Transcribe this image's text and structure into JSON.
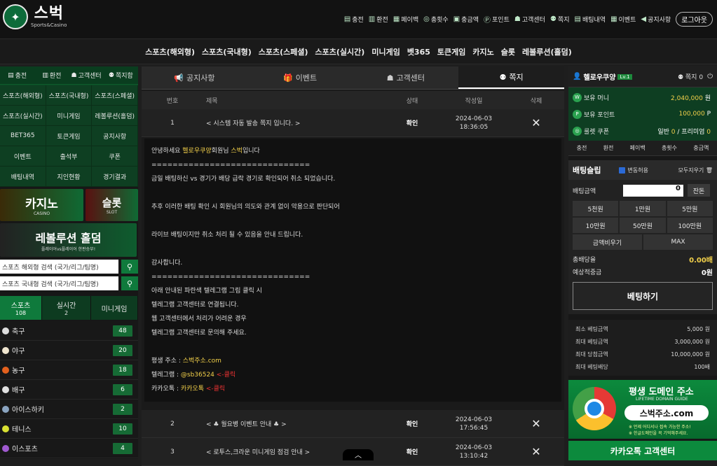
{
  "logo": {
    "title": "스벅",
    "subtitle": "Sports&Casino"
  },
  "topmenu": [
    {
      "icon": "charge-icon",
      "glyph": "▤",
      "label": "충전"
    },
    {
      "icon": "exchange-icon",
      "glyph": "▥",
      "label": "환전"
    },
    {
      "icon": "payback-icon",
      "glyph": "▦",
      "label": "페이백"
    },
    {
      "icon": "total-charge-icon",
      "glyph": "◎",
      "label": "총횟수"
    },
    {
      "icon": "total-amount-icon",
      "glyph": "▣",
      "label": "충금액"
    },
    {
      "icon": "point-icon",
      "glyph": "Ⓟ",
      "label": "포인트"
    },
    {
      "icon": "support-icon",
      "glyph": "☗",
      "label": "고객센터"
    },
    {
      "icon": "message-icon",
      "glyph": "⚉",
      "label": "쪽지"
    },
    {
      "icon": "bet-history-icon",
      "glyph": "▤",
      "label": "배팅내역"
    },
    {
      "icon": "event-icon",
      "glyph": "▦",
      "label": "이벤트"
    },
    {
      "icon": "notice-icon",
      "glyph": "◀",
      "label": "공지사항"
    }
  ],
  "logout": "로그아웃",
  "mainnav": [
    "스포츠(해외형)",
    "스포츠(국내형)",
    "스포츠(스페셜)",
    "스포츠(실시간)",
    "미니게임",
    "벳365",
    "토큰게임",
    "카지노",
    "슬롯",
    "레볼루션(홀덤)"
  ],
  "left": {
    "quick": [
      {
        "glyph": "▤",
        "label": "충전"
      },
      {
        "glyph": "▥",
        "label": "환전"
      },
      {
        "glyph": "☗",
        "label": "고객센터"
      },
      {
        "glyph": "⚉",
        "label": "쪽지함"
      }
    ],
    "grid": [
      "스포츠(해외형)",
      "스포츠(국내형)",
      "스포츠(스페셜)",
      "스포츠(실시간)",
      "미니게임",
      "레볼루션(홀덤)",
      "BET365",
      "토큰게임",
      "공지사항",
      "이벤트",
      "출석부",
      "쿠폰",
      "배팅내역",
      "지인현황",
      "경기결과"
    ],
    "banner_casino": "카지노",
    "banner_casino_sub": "CASINO",
    "banner_slot": "슬롯",
    "banner_slot_sub": "SLOT",
    "banner_holdem": "레볼루션 홀덤",
    "banner_holdem_sub": "플레이어vs플레이어 한판승부!",
    "search1": "스포츠 해외형 검색 (국가/리그/팀명)",
    "search2": "스포츠 국내형 검색 (국가/리그/팀명)",
    "tabs": [
      {
        "label": "스포츠",
        "count": "108"
      },
      {
        "label": "실시간",
        "count": "2"
      },
      {
        "label": "미니게임",
        "count": ""
      }
    ],
    "sports": [
      {
        "name": "축구",
        "count": "48",
        "color": "#dddddd"
      },
      {
        "name": "야구",
        "count": "20",
        "color": "#f0e6d0"
      },
      {
        "name": "농구",
        "count": "18",
        "color": "#e3611e"
      },
      {
        "name": "배구",
        "count": "6",
        "color": "#e0e0e0"
      },
      {
        "name": "아이스하키",
        "count": "2",
        "color": "#8aa4c0"
      },
      {
        "name": "테니스",
        "count": "10",
        "color": "#d8e032"
      },
      {
        "name": "이스포츠",
        "count": "4",
        "color": "#a05ad0"
      }
    ]
  },
  "center": {
    "tabs": [
      {
        "glyph": "📢",
        "label": "공지사항"
      },
      {
        "glyph": "🎁",
        "label": "이벤트"
      },
      {
        "glyph": "☗",
        "label": "고객센터"
      },
      {
        "glyph": "⚉",
        "label": "쪽지"
      }
    ],
    "headers": {
      "no": "번호",
      "title": "제목",
      "status": "상태",
      "date": "작성일",
      "del": "삭제"
    },
    "row1": {
      "no": "1",
      "title": "< 시스템 자동 발송 쪽지 입니다. >",
      "status": "확인",
      "date": "2024-06-03",
      "time": "18:36:05"
    },
    "message": {
      "l1a": "안녕하세요 ",
      "l1b": "헬로우쿠양",
      "l1c": "회원님 ",
      "l1d": "스벅",
      "l1e": "입니다",
      "sep1": "==============================",
      "l2": "금일 배팅하신 vs 경기가 배당 급락 경기로 확인되어 취소 되었습니다.",
      "l3": "추후 이러한 배팅 확인 시 회원님의 의도와 관계 없이 악용으로 판단되어",
      "l4": "라이브 배팅이지만 취소 처리 될 수 있음을 안내 드립니다.",
      "l5": "감사합니다.",
      "sep2": "==============================",
      "l6": "아래 안내된 파란색 텔레그램 그림 클릭 시",
      "l7": "텔레그램 고객센터로 연결됩니다.",
      "l8": "웹 고객센터에서 처리가 어려운 경우",
      "l9": "텔레그램 고객센터로 문의해 주세요.",
      "addr_label": "평생 주소 : ",
      "addr": "스벅주소.com",
      "tg_label": "텔레그램 : ",
      "tg": "@sb36524",
      "tg_click": " <-클릭",
      "kk_label": "카카오톡 : ",
      "kk": "카카오톡",
      "kk_click": " <-클릭"
    },
    "row2": {
      "no": "2",
      "title": "< ♣ 월요병 이벤트 안내 ♣ >",
      "status": "확인",
      "date": "2024-06-03",
      "time": "17:56:45"
    },
    "row3": {
      "no": "3",
      "title": "< 로투스,크라운 미니게임 점검 안내 >",
      "status": "확인",
      "date": "2024-06-03",
      "time": "13:10:42"
    },
    "del_glyph": "✕"
  },
  "right": {
    "user": "헬로우쿠양",
    "level": "Lv.1",
    "msg_label": "쪽지",
    "msg_count": "0",
    "money_label": "보유 머니",
    "money": "2,040,000",
    "money_unit": " 원",
    "point_label": "보유 포인트",
    "point": "100,000",
    "point_unit": " P",
    "coupon_label": "룰렛 쿠폰",
    "coupon_normal_label": "일반 ",
    "coupon_normal": "0",
    "coupon_premium_label": " / 프리미엄 ",
    "coupon_premium": "0",
    "quick": [
      "충전",
      "환전",
      "페이백",
      "총횟수",
      "충금액"
    ],
    "slip_title": "배팅슬립",
    "change_label": "변동허용",
    "clear_all": "모두지우기",
    "amount_label": "배팅금액",
    "amount": "0",
    "balance": "잔돈",
    "buttons": [
      "5천원",
      "1만원",
      "5만원",
      "10만원",
      "50만원",
      "100만원"
    ],
    "reset": "금액비우기",
    "max": "MAX",
    "odds_label": "총배당율",
    "odds": "0.00배",
    "win_label": "예상적중금",
    "win": "0원",
    "bet_button": "베팅하기",
    "limits": [
      {
        "label": "최소 베팅금액",
        "value": "5,000 원"
      },
      {
        "label": "최대 베팅금액",
        "value": "3,000,000 원"
      },
      {
        "label": "최대 당첨금액",
        "value": "10,000,000 원"
      },
      {
        "label": "최대 베팅배당",
        "value": "100배"
      }
    ],
    "domain_title": "평생 도메인 주소",
    "domain_sub": "LIFETIME DOMAIN GUIDE",
    "domain_url": "스벅주소.com",
    "domain_note1": "※ 언제 어디서나 접속 가능한 주소!",
    "domain_note2": "※ 한글도메인을 꼭 기억해주세요.",
    "kakao": "카카오톡 고객센터"
  }
}
